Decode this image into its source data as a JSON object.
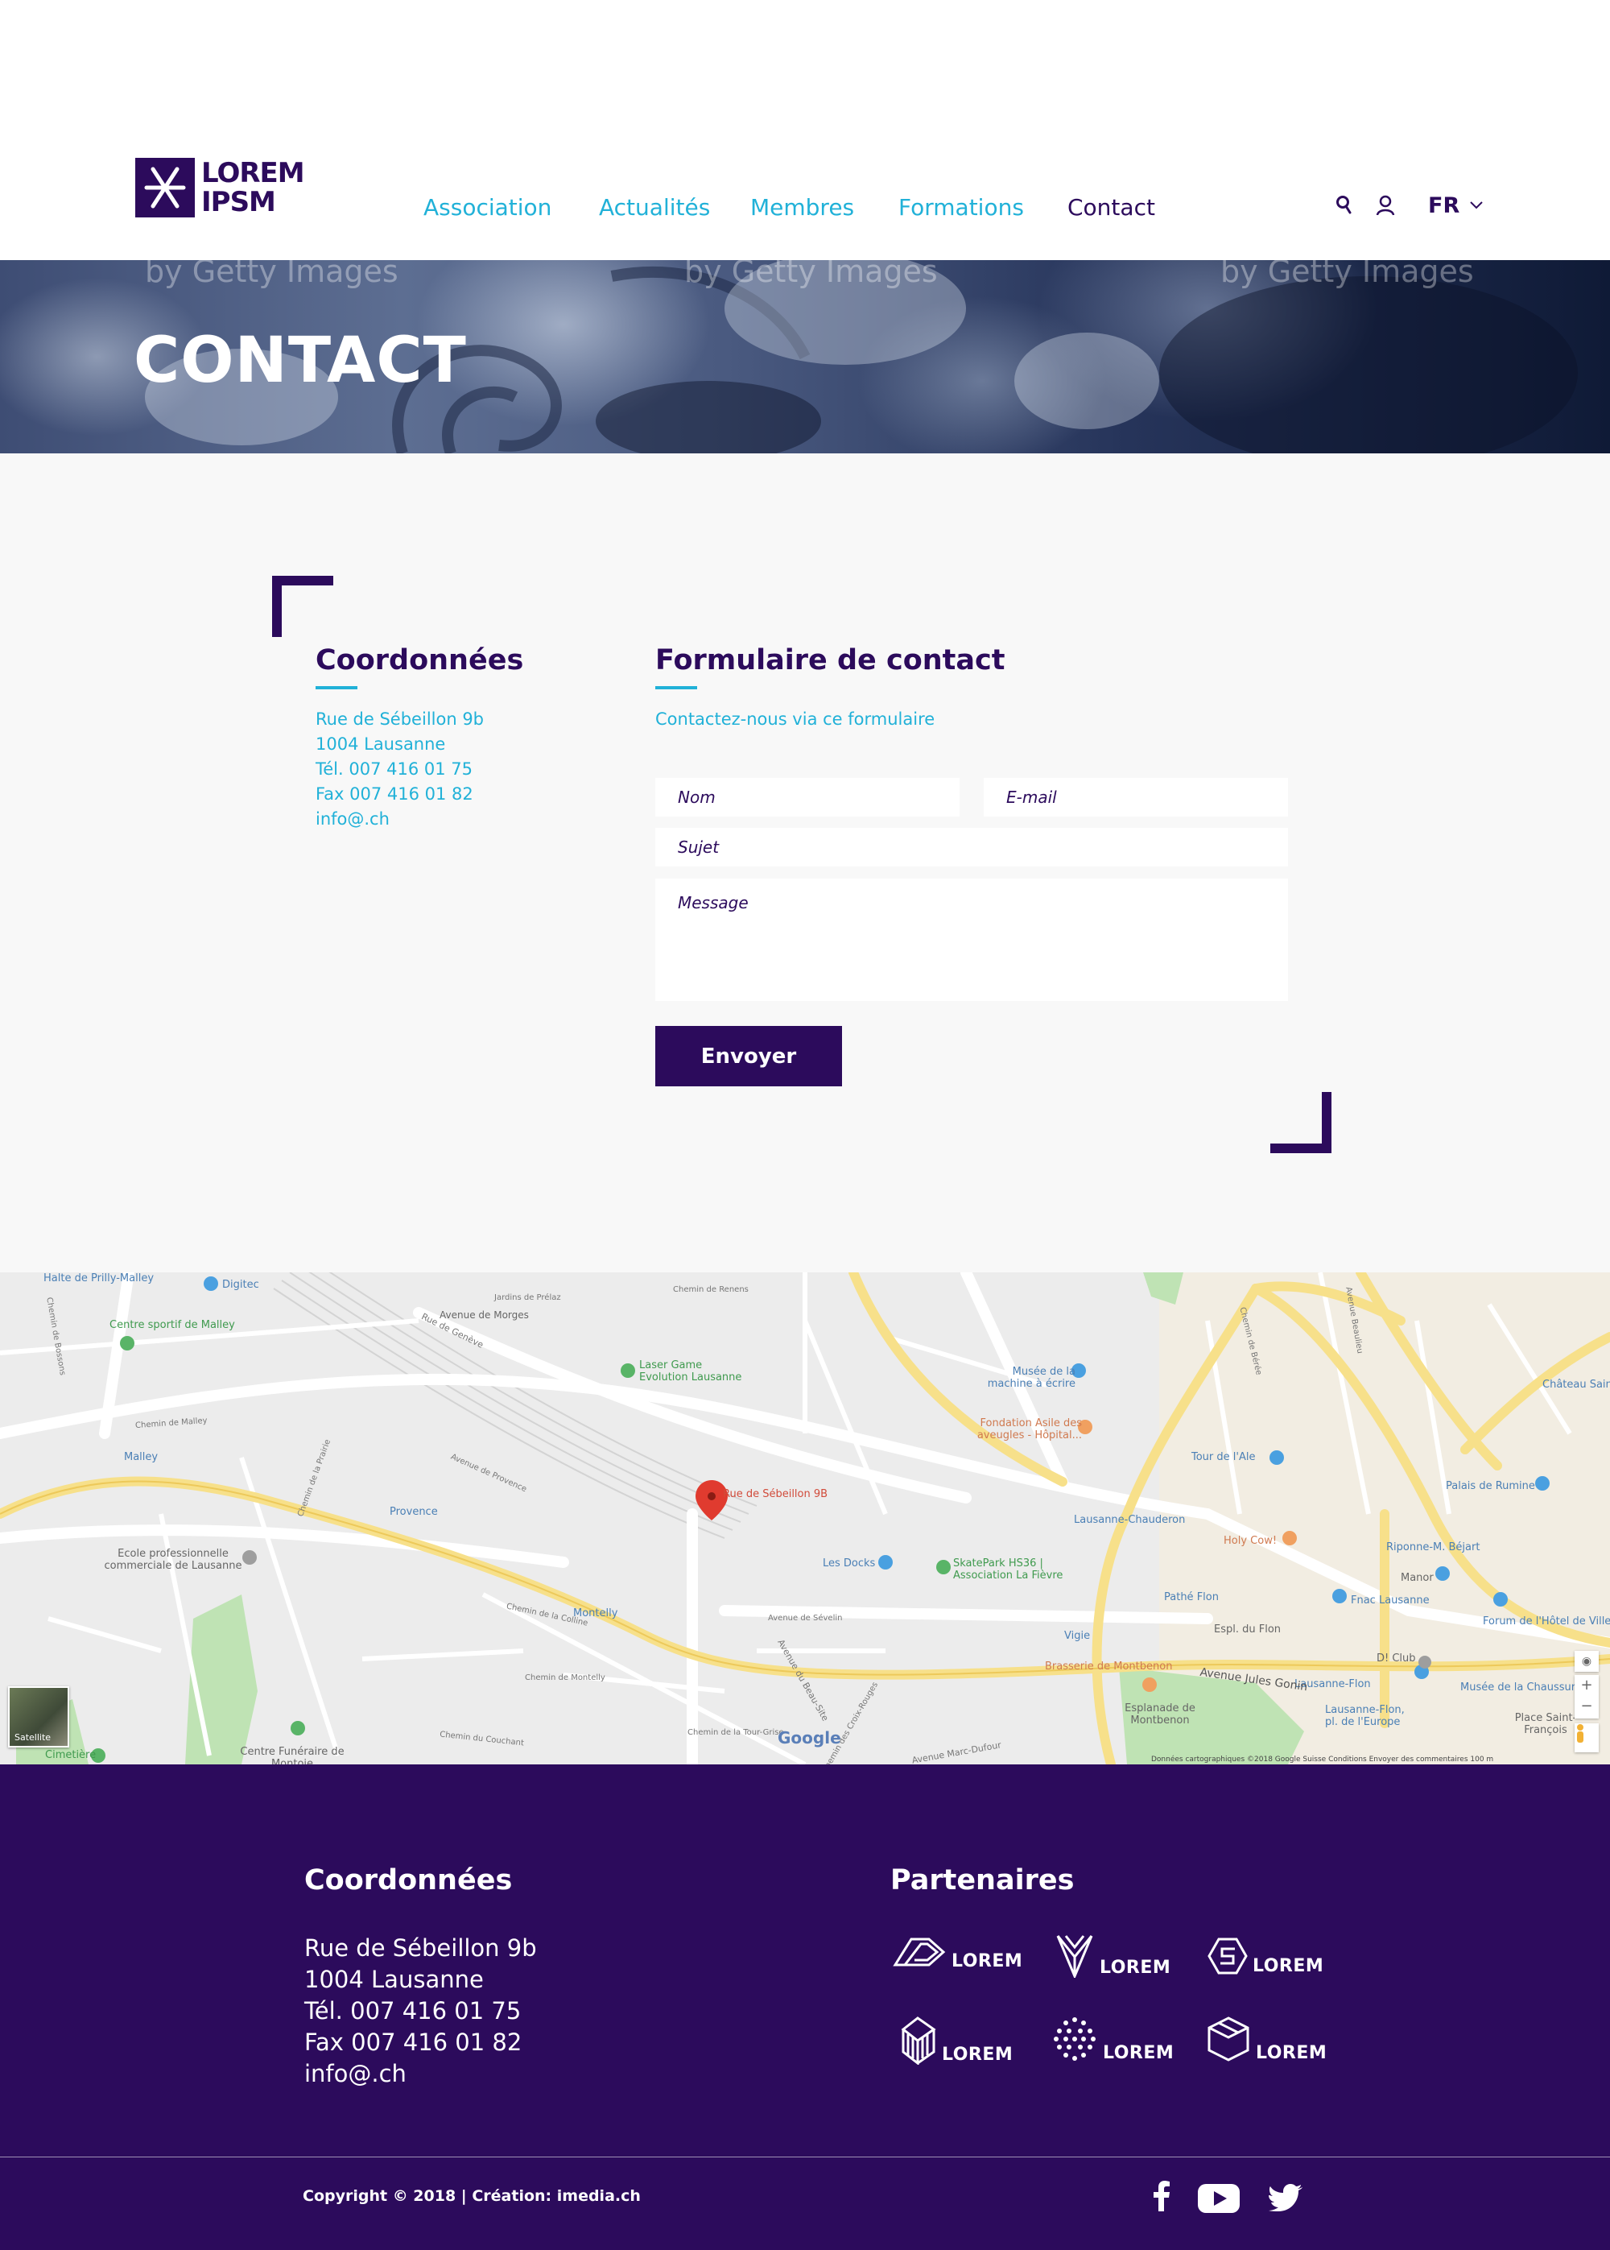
{
  "brand": {
    "line1": "LOREM",
    "line2": "IPSM"
  },
  "nav": {
    "items": [
      {
        "label": "Association"
      },
      {
        "label": "Actualités"
      },
      {
        "label": "Membres"
      },
      {
        "label": "Formations"
      },
      {
        "label": "Contact"
      }
    ],
    "active": "Contact"
  },
  "header_tools": {
    "language": "FR",
    "icons": [
      "search-icon",
      "user-icon",
      "chevron-down-icon"
    ]
  },
  "hero": {
    "title": "CONTACT",
    "watermark": "by Getty Images"
  },
  "coordonnees": {
    "title": "Coordonnées",
    "lines": [
      "Rue de Sébeillon 9b",
      "1004 Lausanne",
      "Tél. 007 416 01 75",
      "Fax 007 416 01 82",
      "info@.ch"
    ]
  },
  "form": {
    "title": "Formulaire de contact",
    "intro": "Contactez-nous via ce formulaire",
    "placeholders": {
      "name": "Nom",
      "email": "E-mail",
      "subject": "Sujet",
      "message": "Message"
    },
    "submit_label": "Envoyer"
  },
  "map": {
    "marker_label": "Rue de Sébeillon 9B",
    "labels": [
      "Halte de Prilly-Malley",
      "Digitec",
      "Centre sportif de Malley",
      "Avenue de Morges",
      "Laser Game Evolution Lausanne",
      "Musée de la machine à écrire",
      "Fondation Asile des aveugles - Hôpital...",
      "Tour de l'Ale",
      "Palais de Rumine",
      "Château Saint",
      "Malley",
      "Provence",
      "Lausanne-Chauderon",
      "Holy Cow!",
      "Riponne-M. Béjart",
      "Ecole professionnelle commerciale de Lausanne",
      "Les Docks",
      "SkatePark HS36 | Association La Fièvre",
      "Pathé Flon",
      "Fnac Lausanne",
      "Manor",
      "Forum de l'Hôtel de Ville",
      "Montelly",
      "Espl. du Flon",
      "Vigie",
      "Brasserie de Montbenon",
      "D! Club",
      "Lausanne-Flon",
      "Esplanade de Montbenon",
      "Lausanne-Flon, pl. de l'Europe",
      "Musée de la Chaussure",
      "Place Saint-François",
      "Centre Funéraire de Montoie",
      "Cimetière",
      "Avenue Jules Gonin",
      "Avenue Marc-Dufour",
      "Rue de Genève",
      "Avenue de Sévelin",
      "Chemin de Renens",
      "Jardins de Prélaz",
      "Chemin de Malley",
      "Chemin de la Prairie",
      "Avenue de Provence",
      "Chemin de la Colline",
      "Chemin de Montelly",
      "Chemin du Couchant",
      "Chemin de la Tour-Grise",
      "Chemin des Croix-Rouges",
      "Chemin de Bossons",
      "Avenue du Beau-Site",
      "Avenue Beaulieu",
      "Chemin de Bérée"
    ],
    "attribution": "Données cartographiques ©2018 Google   Suisse   Conditions   Envoyer des commentaires   100 m",
    "satellite_label": "Satellite",
    "google": "Google",
    "controls": [
      "+",
      "−"
    ]
  },
  "footer": {
    "coord_title": "Coordonnées",
    "coord_lines": [
      "Rue de Sébeillon 9b",
      "1004 Lausanne",
      "Tél. 007 416 01 75",
      "Fax 007 416 01 82",
      "info@.ch"
    ],
    "partners_title": "Partenaires",
    "partners": [
      {
        "label": "LOREM",
        "icon": "arrow-shape-icon"
      },
      {
        "label": "LOREM",
        "icon": "y-shape-icon"
      },
      {
        "label": "LOREM",
        "icon": "s-hexagon-icon"
      },
      {
        "label": "LOREM",
        "icon": "striped-cube-icon"
      },
      {
        "label": "LOREM",
        "icon": "dot-circle-icon"
      },
      {
        "label": "LOREM",
        "icon": "cube-icon"
      }
    ],
    "copyright": "Copyright © 2018 | Création: imedia.ch",
    "social": [
      "facebook-icon",
      "youtube-icon",
      "twitter-icon"
    ]
  },
  "colors": {
    "primary": "#2c0b5c",
    "accent": "#21b1d8",
    "background": "#f8f8f8"
  }
}
